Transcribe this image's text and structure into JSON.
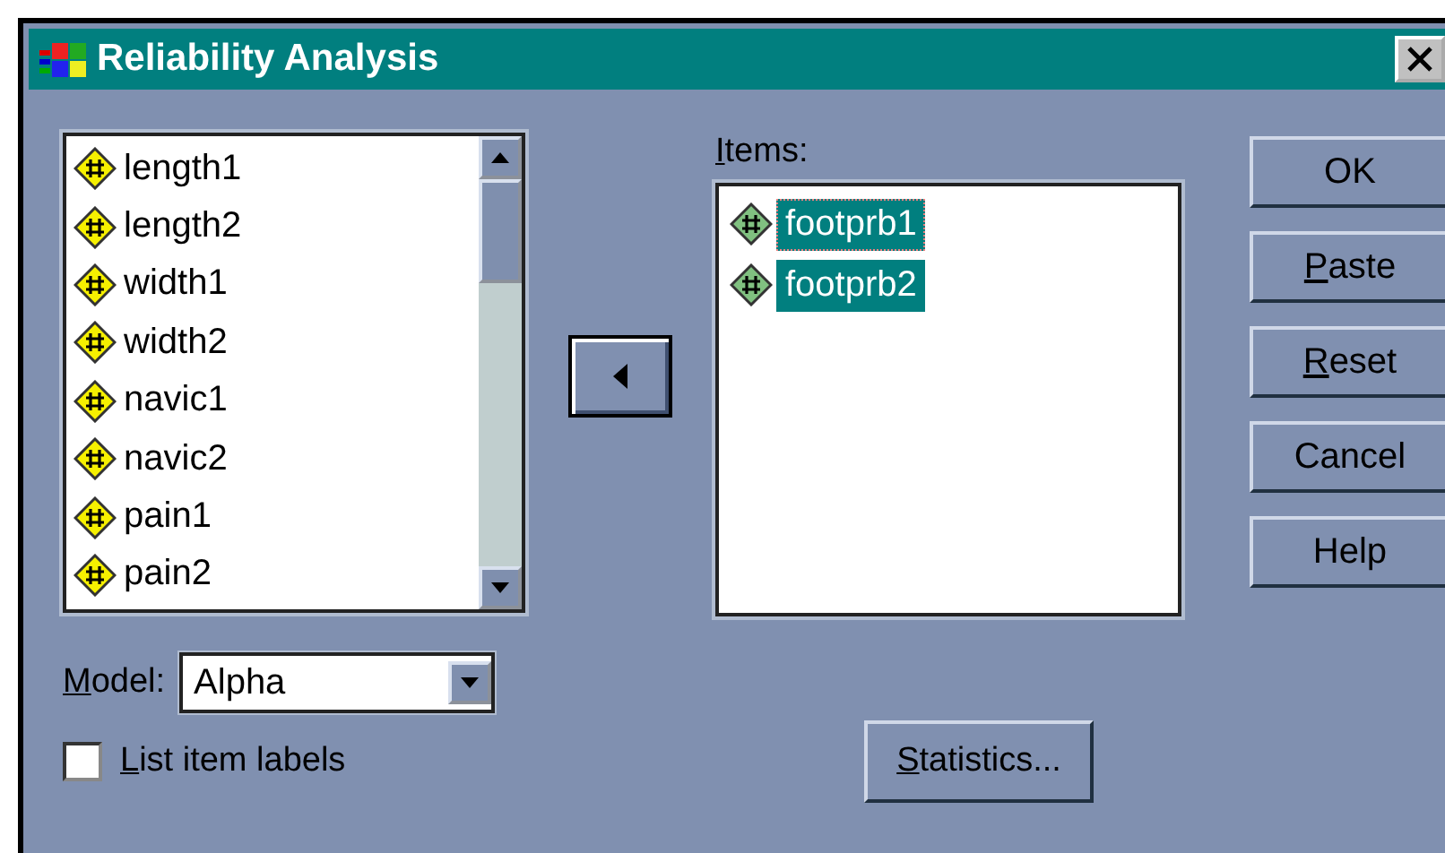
{
  "window": {
    "title": "Reliability Analysis"
  },
  "variables": [
    {
      "name": "length1"
    },
    {
      "name": "length2"
    },
    {
      "name": "width1"
    },
    {
      "name": "width2"
    },
    {
      "name": "navic1"
    },
    {
      "name": "navic2"
    },
    {
      "name": "pain1"
    },
    {
      "name": "pain2"
    }
  ],
  "items_label": {
    "text": "Items:",
    "underline_first": true
  },
  "items": [
    {
      "name": "footprb1",
      "selected": true,
      "focused": true
    },
    {
      "name": "footprb2",
      "selected": true,
      "focused": false
    }
  ],
  "buttons": [
    {
      "label": "OK",
      "underline_first": false
    },
    {
      "label": "Paste",
      "underline_first": true
    },
    {
      "label": "Reset",
      "underline_first": true
    },
    {
      "label": "Cancel",
      "underline_first": false
    },
    {
      "label": "Help",
      "underline_first": false
    }
  ],
  "model": {
    "label": "Model:",
    "underline_first": true,
    "value": "Alpha"
  },
  "list_item_labels": {
    "label": "List item labels",
    "underline_first": true,
    "checked": false
  },
  "statistics_button": {
    "label": "Statistics...",
    "underline_first": true
  }
}
